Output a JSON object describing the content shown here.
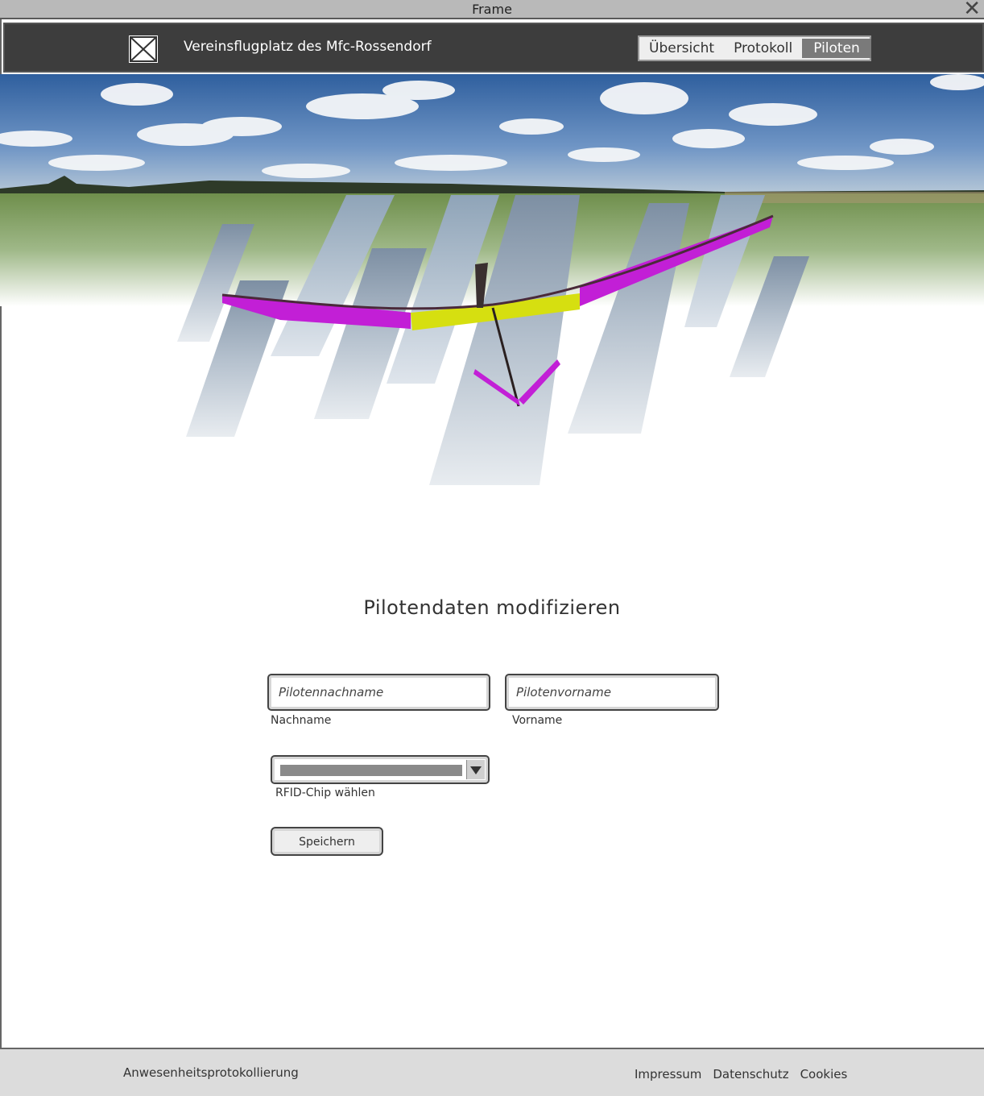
{
  "window": {
    "title": "Frame",
    "close_icon": "close-icon"
  },
  "header": {
    "logo_icon": "image-placeholder-icon",
    "site_title": "Vereinsflugplatz des Mfc-Rossendorf",
    "nav": [
      {
        "label": "Übersicht",
        "active": false
      },
      {
        "label": "Protokoll",
        "active": false
      },
      {
        "label": "Piloten",
        "active": true
      }
    ]
  },
  "form": {
    "heading": "Pilotendaten modifizieren",
    "lastname": {
      "placeholder": "Pilotennachname",
      "label": "Nachname",
      "value": ""
    },
    "firstname": {
      "placeholder": "Pilotenvorname",
      "label": "Vorname",
      "value": ""
    },
    "rfid": {
      "label": "RFID-Chip wählen",
      "selected": ""
    },
    "save_label": "Speichern"
  },
  "footer": {
    "brand": "Anwesenheitsprotokollierung",
    "links": [
      "Impressum",
      "Datenschutz",
      "Cookies"
    ]
  },
  "colors": {
    "header_bg": "#3d3d3d",
    "nav_active": "#7a7a7a",
    "footer_bg": "#dcdcdc",
    "wing_magenta": "#c21fd6",
    "wing_yellow": "#d6df10"
  }
}
